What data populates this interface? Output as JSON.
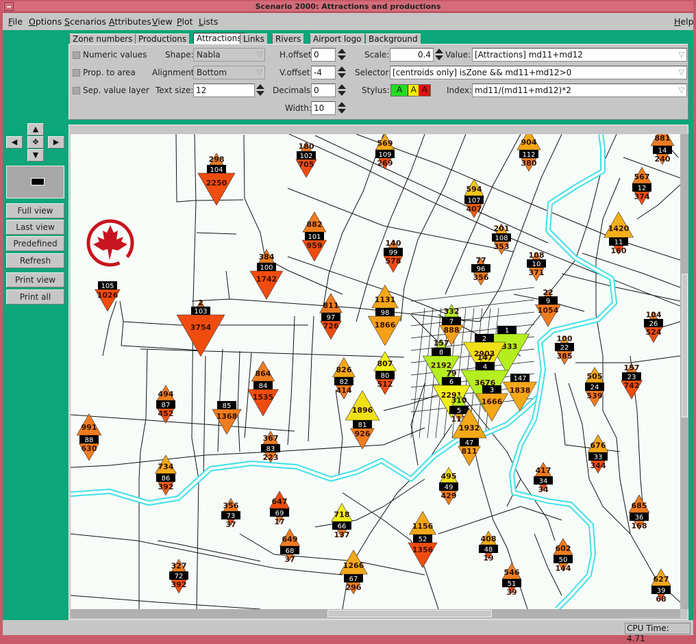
{
  "window": {
    "title": "Scenario 2000: Attractions and productions"
  },
  "menu": {
    "items": [
      "File",
      "Options",
      "Scenarios",
      "Attributes",
      "View",
      "Plot",
      "Lists"
    ],
    "help": "Help"
  },
  "tabs": [
    {
      "label": "Zone numbers",
      "active": false
    },
    {
      "label": "Productions",
      "active": false
    },
    {
      "label": "Attractions",
      "active": true
    },
    {
      "label": "Links",
      "active": false
    },
    {
      "label": "Rivers",
      "active": false
    },
    {
      "label": "Airport logo",
      "active": false
    },
    {
      "label": "Background",
      "active": false
    }
  ],
  "controls": {
    "numeric_values": {
      "label": "Numeric values",
      "checked": false
    },
    "prop_to_area": {
      "label": "Prop. to area",
      "checked": false
    },
    "sep_value_layer": {
      "label": "Sep. value layer",
      "checked": false
    },
    "shape": {
      "label": "Shape:",
      "value": "Nabla"
    },
    "alignment": {
      "label": "Alignment:",
      "value": "Bottom"
    },
    "text_size": {
      "label": "Text size:",
      "value": "12"
    },
    "hoffset": {
      "label": "H.offset:",
      "value": "0"
    },
    "voffset": {
      "label": "V.offset:",
      "value": "-4"
    },
    "decimals": {
      "label": "Decimals:",
      "value": "0"
    },
    "width": {
      "label": "Width:",
      "value": "10"
    },
    "scale": {
      "label": "Scale:",
      "value": "0.4"
    },
    "value": {
      "label": "Value:",
      "value": "[Attractions] md11+md12"
    },
    "selector": {
      "label": "Selector:",
      "value": "[centroids only] isZone && md11+md12>0"
    },
    "stylus": {
      "label": "Stylus:",
      "swatches": [
        {
          "text": "A",
          "color": "#22dd22"
        },
        {
          "text": "A",
          "color": "#f0f000"
        },
        {
          "text": "A",
          "color": "#e01010"
        }
      ]
    },
    "index": {
      "label": "Index:",
      "value": "md11/(md11+md12)*2"
    }
  },
  "nav": {
    "buttons": [
      "Full view",
      "Last view",
      "Predefined",
      "Refresh",
      "Print view",
      "Print all"
    ]
  },
  "status": {
    "cpu_time": "CPU Time: 4.71"
  },
  "colors": {
    "river": "#40e0e8",
    "road": "#111111",
    "logo": "#c8141e",
    "zone_box": "#000000"
  },
  "map": {
    "markers": [
      {
        "zone": "104",
        "production": "298",
        "attraction": "2250",
        "up_color": "#f07c20",
        "down_color": "#f04c10"
      },
      {
        "zone": "100",
        "production": "384",
        "attraction": "1742",
        "up_color": "#f07c20",
        "down_color": "#f04c10"
      },
      {
        "zone": "105",
        "production": "",
        "attraction": "1026",
        "up_color": "#f07c20",
        "down_color": "#f04c10"
      },
      {
        "zone": "103",
        "production": "2",
        "attraction": "3754",
        "up_color": "#f07c20",
        "down_color": "#f04c10"
      },
      {
        "zone": "102",
        "production": "180",
        "attraction": "705",
        "up_color": "#f07c20",
        "down_color": "#f04c10"
      },
      {
        "zone": "109",
        "production": "569",
        "attraction": "269",
        "up_color": "#f4a818",
        "down_color": "#f04c10"
      },
      {
        "zone": "107",
        "production": "594",
        "attraction": "407",
        "up_color": "#f0c818",
        "down_color": "#f05c10"
      },
      {
        "zone": "101",
        "production": "882",
        "attraction": "959",
        "up_color": "#f07c20",
        "down_color": "#f04c10"
      },
      {
        "zone": "99",
        "production": "140",
        "attraction": "578",
        "up_color": "#f07c20",
        "down_color": "#f04c10"
      },
      {
        "zone": "108",
        "production": "201",
        "attraction": "353",
        "up_color": "#f4a818",
        "down_color": "#f07c20"
      },
      {
        "zone": "96",
        "production": "77",
        "attraction": "356",
        "up_color": "#f07c20",
        "down_color": "#f07c20"
      },
      {
        "zone": "97",
        "production": "811",
        "attraction": "726",
        "up_color": "#f07c20",
        "down_color": "#f04c10"
      },
      {
        "zone": "98",
        "production": "1131",
        "attraction": "1866",
        "up_color": "#f4a818",
        "down_color": "#f4a018"
      },
      {
        "zone": "7",
        "production": "332",
        "attraction": "888",
        "up_color": "#b4ee20",
        "down_color": "#f4a018"
      },
      {
        "zone": "112",
        "production": "904",
        "attraction": "380",
        "up_color": "#f4a818",
        "down_color": "#f07c20"
      },
      {
        "zone": "14",
        "production": "881",
        "attraction": "240",
        "up_color": "#f07c20",
        "down_color": "#f07c20"
      },
      {
        "zone": "12",
        "production": "567",
        "attraction": "374",
        "up_color": "#f07c20",
        "down_color": "#f04c10"
      },
      {
        "zone": "11",
        "production": "1420",
        "attraction": "160",
        "up_color": "#f4b018",
        "down_color": "#f04c10"
      },
      {
        "zone": "10",
        "production": "108",
        "attraction": "371",
        "up_color": "#f07c20",
        "down_color": "#f07c20"
      },
      {
        "zone": "9",
        "production": "22",
        "attraction": "1054",
        "up_color": "#f07c20",
        "down_color": "#f07c20"
      },
      {
        "zone": "26",
        "production": "104",
        "attraction": "524",
        "up_color": "#f07c20",
        "down_color": "#f04c10"
      },
      {
        "zone": "22",
        "production": "100",
        "attraction": "385",
        "up_color": "#f4a818",
        "down_color": "#f07c20"
      },
      {
        "zone": "1",
        "production": "",
        "attraction": "3333",
        "up_color": "#b4ee20",
        "down_color": "#b4ee20"
      },
      {
        "zone": "2",
        "production": "",
        "attraction": "2903",
        "up_color": "#f0e018",
        "down_color": "#f0e018"
      },
      {
        "zone": "8",
        "production": "157",
        "attraction": "2192",
        "up_color": "#b4ee20",
        "down_color": "#b4ee20"
      },
      {
        "zone": "4",
        "production": "147",
        "attraction": "3676",
        "up_color": "#f0e018",
        "down_color": "#b4ee20"
      },
      {
        "zone": "6",
        "production": "79",
        "attraction": "2291",
        "up_color": "#b4ee20",
        "down_color": "#f0f018"
      },
      {
        "zone": "3",
        "production": "",
        "attraction": "1666",
        "up_color": "#f4a818",
        "down_color": "#f4a818"
      },
      {
        "zone": "147",
        "production": "",
        "attraction": "1838",
        "up_color": "#f4a818",
        "down_color": "#f4a818"
      },
      {
        "zone": "5",
        "production": "310",
        "attraction": "113",
        "up_color": "#b4ee20",
        "down_color": "#f4a818"
      },
      {
        "zone": "47",
        "production": "1932",
        "attraction": "811",
        "up_color": "#f4a818",
        "down_color": "#f4a018"
      },
      {
        "zone": "87",
        "production": "494",
        "attraction": "452",
        "up_color": "#f07c20",
        "down_color": "#f05010"
      },
      {
        "zone": "85",
        "production": "",
        "attraction": "1368",
        "up_color": "#f07c20",
        "down_color": "#f07c20"
      },
      {
        "zone": "84",
        "production": "864",
        "attraction": "1535",
        "up_color": "#f07c20",
        "down_color": "#f04c10"
      },
      {
        "zone": "82",
        "production": "826",
        "attraction": "414",
        "up_color": "#f4a818",
        "down_color": "#f07c20"
      },
      {
        "zone": "80",
        "production": "807",
        "attraction": "512",
        "up_color": "#f0f018",
        "down_color": "#f04c10"
      },
      {
        "zone": "81",
        "production": "1896",
        "attraction": "926",
        "up_color": "#f0e018",
        "down_color": "#f07c20"
      },
      {
        "zone": "88",
        "production": "991",
        "attraction": "630",
        "up_color": "#f07c20",
        "down_color": "#f07c20"
      },
      {
        "zone": "83",
        "production": "367",
        "attraction": "223",
        "up_color": "#f07c20",
        "down_color": "#f07c20"
      },
      {
        "zone": "86",
        "production": "734",
        "attraction": "392",
        "up_color": "#f4a818",
        "down_color": "#f06020"
      },
      {
        "zone": "73",
        "production": "356",
        "attraction": "37",
        "up_color": "#f07c20",
        "down_color": "#f04c10"
      },
      {
        "zone": "69",
        "production": "647",
        "attraction": "17",
        "up_color": "#f04c10",
        "down_color": "#f07c20"
      },
      {
        "zone": "66",
        "production": "718",
        "attraction": "137",
        "up_color": "#f0f018",
        "down_color": "#f07c20"
      },
      {
        "zone": "68",
        "production": "649",
        "attraction": "37",
        "up_color": "#f07c20",
        "down_color": "#f07c20"
      },
      {
        "zone": "72",
        "production": "327",
        "attraction": "392",
        "up_color": "#f07c20",
        "down_color": "#f04c10"
      },
      {
        "zone": "67",
        "production": "1266",
        "attraction": "296",
        "up_color": "#f4a818",
        "down_color": "#f07c20"
      },
      {
        "zone": "49",
        "production": "495",
        "attraction": "429",
        "up_color": "#f0e018",
        "down_color": "#f07c20"
      },
      {
        "zone": "52",
        "production": "1156",
        "attraction": "1356",
        "up_color": "#f4a818",
        "down_color": "#f04c10"
      },
      {
        "zone": "48",
        "production": "408",
        "attraction": "19",
        "up_color": "#f4a818",
        "down_color": "#f04c10"
      },
      {
        "zone": "51",
        "production": "546",
        "attraction": "39",
        "up_color": "#f07c20",
        "down_color": "#f04c10"
      },
      {
        "zone": "50",
        "production": "602",
        "attraction": "144",
        "up_color": "#f07c20",
        "down_color": "#f07c20"
      },
      {
        "zone": "34",
        "production": "417",
        "attraction": "34",
        "up_color": "#f07c20",
        "down_color": "#f04c10"
      },
      {
        "zone": "33",
        "production": "676",
        "attraction": "344",
        "up_color": "#f4a818",
        "down_color": "#f04c10"
      },
      {
        "zone": "24",
        "production": "505",
        "attraction": "539",
        "up_color": "#f4a818",
        "down_color": "#f07c20"
      },
      {
        "zone": "23",
        "production": "157",
        "attraction": "742",
        "up_color": "#f07c20",
        "down_color": "#f04c10"
      },
      {
        "zone": "36",
        "production": "685",
        "attraction": "168",
        "up_color": "#f07c20",
        "down_color": "#f07c20"
      },
      {
        "zone": "39",
        "production": "627",
        "attraction": "68",
        "up_color": "#f4a818",
        "down_color": "#f04c10"
      }
    ]
  }
}
